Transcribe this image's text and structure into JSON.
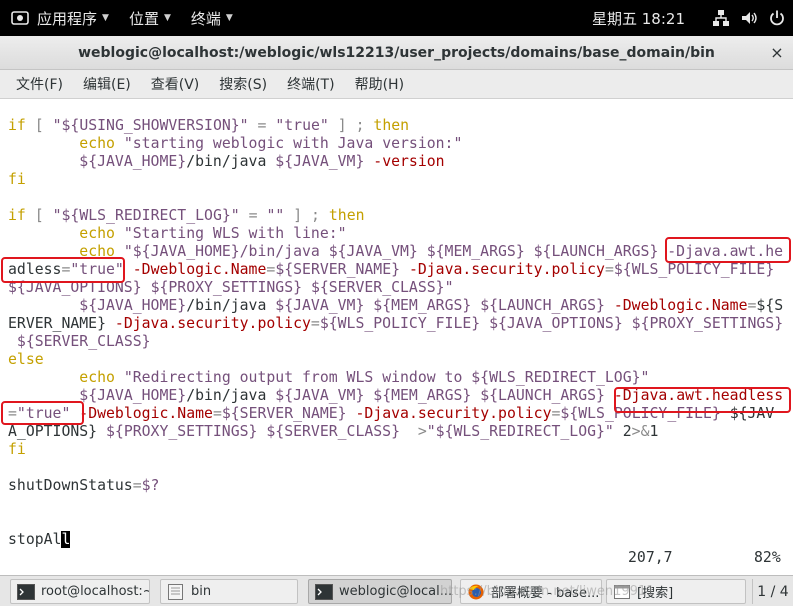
{
  "topbar": {
    "applications": "应用程序",
    "places": "位置",
    "terminal": "终端",
    "clock": "星期五 18:21",
    "tray_icons": [
      "network-icon",
      "volume-icon",
      "power-icon"
    ]
  },
  "window": {
    "title": "weblogic@localhost:/weblogic/wls12213/user_projects/domains/base_domain/bin",
    "close_glyph": "×"
  },
  "menu": [
    {
      "label": "文件(F)"
    },
    {
      "label": "编辑(E)"
    },
    {
      "label": "查看(V)"
    },
    {
      "label": "搜索(S)"
    },
    {
      "label": "终端(T)"
    },
    {
      "label": "帮助(H)"
    }
  ],
  "terminal": {
    "lines": [
      "if [ \"${USING_SHOWVERSION}\" = \"true\" ] ; then",
      "        echo \"starting weblogic with Java version:\"",
      "        ${JAVA_HOME}/bin/java ${JAVA_VM} -version",
      "fi",
      "",
      "if [ \"${WLS_REDIRECT_LOG}\" = \"\" ] ; then",
      "        echo \"Starting WLS with line:\"",
      "        echo \"${JAVA_HOME}/bin/java ${JAVA_VM} ${MEM_ARGS} ${LAUNCH_ARGS} -Djava.awt.he",
      "adless=\"true\" -Dweblogic.Name=${SERVER_NAME} -Djava.security.policy=${WLS_POLICY_FILE}",
      "${JAVA_OPTIONS} ${PROXY_SETTINGS} ${SERVER_CLASS}\"",
      "        ${JAVA_HOME}/bin/java ${JAVA_VM} ${MEM_ARGS} ${LAUNCH_ARGS} -Dweblogic.Name=${S",
      "ERVER_NAME} -Djava.security.policy=${WLS_POLICY_FILE} ${JAVA_OPTIONS} ${PROXY_SETTINGS}",
      " ${SERVER_CLASS}",
      "else",
      "        echo \"Redirecting output from WLS window to ${WLS_REDIRECT_LOG}\"",
      "        ${JAVA_HOME}/bin/java ${JAVA_VM} ${MEM_ARGS} ${LAUNCH_ARGS} -Djava.awt.headless",
      "=\"true\" -Dweblogic.Name=${SERVER_NAME} -Djava.security.policy=${WLS_POLICY_FILE} ${JAV",
      "A_OPTIONS} ${PROXY_SETTINGS} ${SERVER_CLASS}  >\"${WLS_REDIRECT_LOG}\" 2>&1",
      "fi",
      "",
      "shutDownStatus=$?",
      "",
      "",
      "stopAll"
    ],
    "cursor_char": "l",
    "status_position": "207,7",
    "status_percent": "82%"
  },
  "taskbar": {
    "items": [
      {
        "label": "root@localhost:~",
        "icon": "terminal-icon",
        "active": false
      },
      {
        "label": "bin",
        "icon": "folder-icon",
        "active": false
      },
      {
        "label": "weblogic@local...",
        "icon": "terminal-icon",
        "active": true
      },
      {
        "label": "部署概要 - base...",
        "icon": "firefox-icon",
        "active": false
      },
      {
        "label": "[搜索]",
        "icon": "window-icon",
        "active": false
      }
    ],
    "pager": "1 / 4",
    "watermark": "https://blog.csdn.net/liwen19911"
  },
  "colors": {
    "keyword": "#c4a000",
    "string": "#75507b",
    "flag": "#a40000",
    "annotation": "#e0161e",
    "topbar": "#000000"
  }
}
